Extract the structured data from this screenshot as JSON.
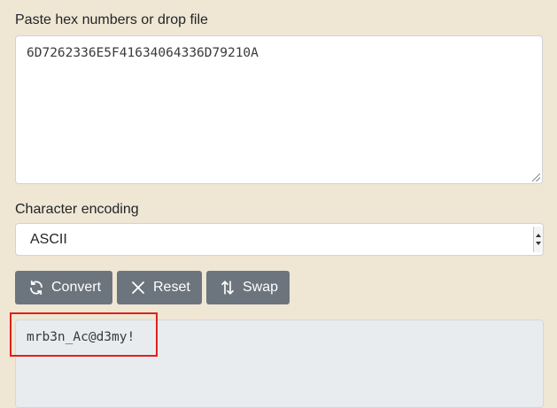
{
  "input_section": {
    "label": "Paste hex numbers or drop file",
    "value": "6D7262336E5F41634064336D79210A"
  },
  "encoding_section": {
    "label": "Character encoding",
    "selected": "ASCII"
  },
  "buttons": {
    "convert": {
      "label": "Convert",
      "icon": "refresh-icon"
    },
    "reset": {
      "label": "Reset",
      "icon": "close-icon"
    },
    "swap": {
      "label": "Swap",
      "icon": "swap-vertical-icon"
    }
  },
  "output_section": {
    "value": "mrb3n_Ac@d3my!"
  },
  "colors": {
    "page_background": "#efe6d4",
    "button": "#6c757d",
    "output_background": "#e9ecef",
    "highlight": "#e0201c"
  }
}
